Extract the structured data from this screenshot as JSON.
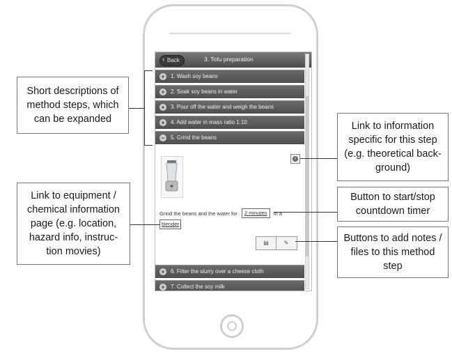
{
  "app": {
    "back_label": "Back",
    "title": "3. Tofu preparation"
  },
  "steps": [
    {
      "icon": "+",
      "label": "1. Wash soy beans"
    },
    {
      "icon": "+",
      "label": "2. Soak soy beans in water"
    },
    {
      "icon": "+",
      "label": "3. Pour off the water and weigh the beans"
    },
    {
      "icon": "+",
      "label": "4. Add water in mass ratio 1:10"
    },
    {
      "icon": "−",
      "label": "5. Grind the beans"
    }
  ],
  "expanded_step": {
    "description_start": "Grind the beans and the water for",
    "timer_label": "2 minutes",
    "description_middle": "in a",
    "equipment_label": "blender",
    "notes_icon": "note-icon",
    "files_icon": "paperclip-icon"
  },
  "more_steps": [
    {
      "icon": "+",
      "label": "6. Filter the slurry over a cheese cloth"
    },
    {
      "icon": "+",
      "label": "7. Collect the soy milk"
    }
  ],
  "callouts": {
    "short_descriptions": "Short descriptions of method steps, which can be expanded",
    "info_link": "Link to information specific for this step (e.g. theoretical back-ground)",
    "timer": "Button to start/stop countdown timer",
    "equipment": "Link to equipment / chemical information page (e.g. location, hazard info, instruc-tion movies)",
    "notes": "Buttons to add notes / files to this method step"
  }
}
